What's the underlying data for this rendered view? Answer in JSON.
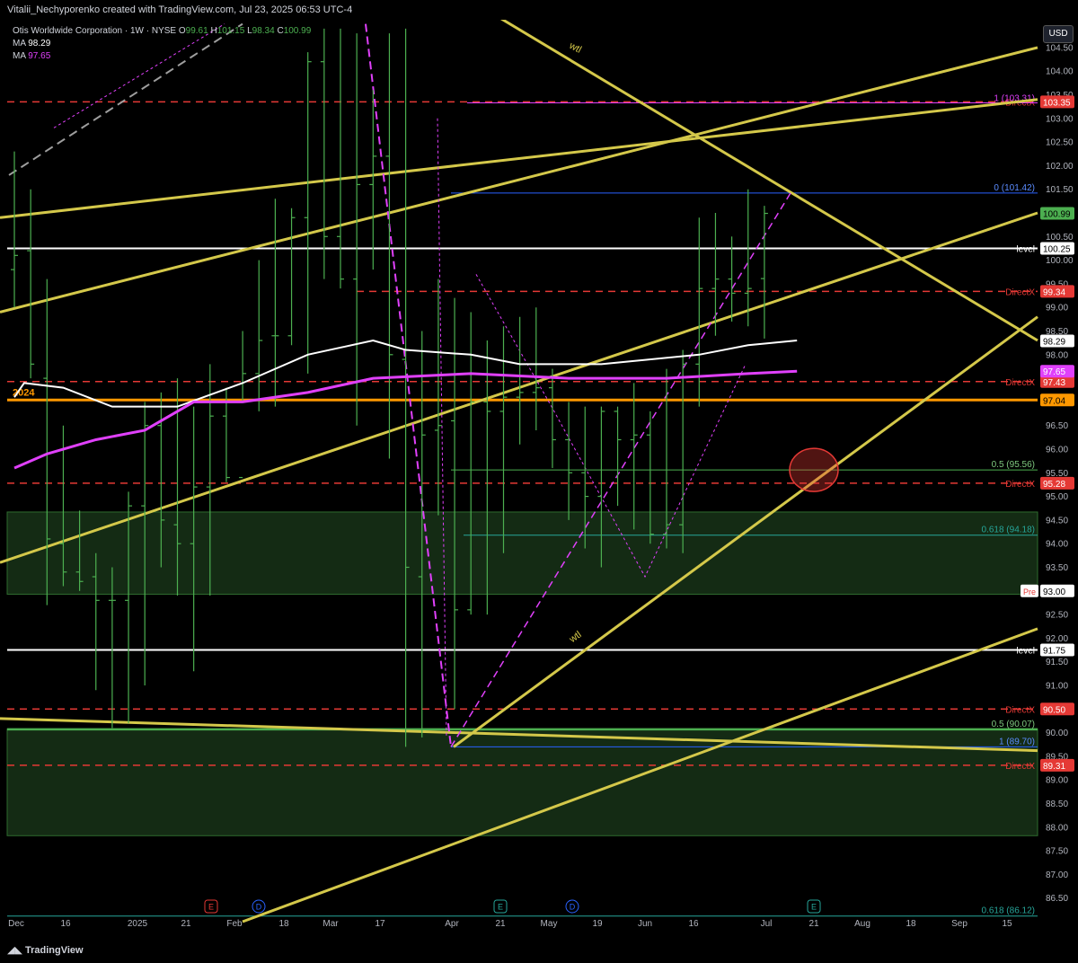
{
  "header": {
    "text": "Vitalii_Nechyporenko created with TradingView.com, Jul 23, 2025 06:53 UTC-4"
  },
  "footer": {
    "brand": "TradingView"
  },
  "legend": {
    "symbol_line": "Otis Worldwide Corporation · 1W · NYSE",
    "o_label": "O",
    "o_value": "99.61",
    "h_label": "H",
    "h_value": "101.15",
    "l_label": "L",
    "l_value": "98.34",
    "c_label": "C",
    "c_value": "100.99",
    "ma1_label": "MA",
    "ma1_value": "98.29",
    "ma2_label": "MA",
    "ma2_value": "97.65"
  },
  "currency_button": "USD",
  "colors": {
    "candle": "#4caf50",
    "ma_white": "#ffffff",
    "ma_magenta": "#e040fb",
    "trend": "#d4c84a",
    "directx": "#e53935",
    "level": "#ffffff",
    "orange": "#ff9800",
    "zone": "#1b3a1b",
    "teal": "#26a69a"
  },
  "chart_data": {
    "type": "line",
    "title": "",
    "y_range": [
      86.0,
      104.9
    ],
    "x_tick_labels": [
      "Dec",
      "16",
      "2025",
      "21",
      "Feb",
      "18",
      "Mar",
      "17",
      "Apr",
      "21",
      "May",
      "19",
      "Jun",
      "16",
      "Jul",
      "21",
      "Aug",
      "18",
      "Sep",
      "15"
    ],
    "y_tick_labels": [
      "104.50",
      "104.00",
      "103.50",
      "103.00",
      "102.50",
      "102.00",
      "101.50",
      "100.50",
      "100.00",
      "99.50",
      "99.00",
      "98.50",
      "98.00",
      "96.50",
      "96.00",
      "95.50",
      "95.00",
      "94.50",
      "94.00",
      "93.50",
      "92.50",
      "92.00",
      "91.50",
      "91.00",
      "90.50",
      "90.00",
      "89.50",
      "89.00",
      "88.50",
      "88.00",
      "87.50",
      "87.00",
      "86.50"
    ],
    "ohlc_weekly": [
      [
        99.8,
        102.3,
        99.0,
        100.1
      ],
      [
        100.2,
        101.5,
        97.5,
        97.8
      ],
      [
        97.5,
        99.6,
        92.7,
        94.1
      ],
      [
        94.0,
        96.5,
        93.1,
        93.4
      ],
      [
        93.4,
        94.7,
        93.0,
        93.2
      ],
      [
        93.3,
        93.8,
        90.9,
        92.8
      ],
      [
        92.8,
        93.5,
        90.1,
        92.8
      ],
      [
        92.8,
        95.1,
        90.2,
        94.8
      ],
      [
        94.8,
        97.0,
        91.0,
        96.5
      ],
      [
        96.5,
        97.2,
        93.5,
        94.5
      ],
      [
        94.4,
        97.5,
        92.9,
        94.0
      ],
      [
        94.0,
        96.9,
        91.3,
        95.2
      ],
      [
        95.2,
        97.8,
        92.9,
        96.7
      ],
      [
        96.7,
        97.3,
        95.3,
        95.4
      ],
      [
        95.4,
        98.5,
        97.0,
        97.6
      ],
      [
        97.6,
        100.0,
        96.8,
        98.3
      ],
      [
        98.4,
        101.3,
        96.9,
        98.4
      ],
      [
        98.4,
        101.1,
        98.2,
        100.9
      ],
      [
        100.9,
        104.4,
        97.6,
        104.2
      ],
      [
        104.2,
        104.9,
        99.6,
        100.5
      ],
      [
        100.5,
        104.9,
        99.4,
        99.6
      ],
      [
        99.6,
        104.8,
        96.5,
        101.6
      ],
      [
        101.6,
        103.6,
        99.8,
        102.2
      ],
      [
        102.2,
        104.8,
        95.8,
        98.0
      ],
      [
        97.9,
        104.9,
        89.7,
        93.5
      ],
      [
        93.3,
        98.5,
        89.9,
        96.3
      ],
      [
        96.4,
        99.6,
        94.6,
        96.5
      ],
      [
        96.6,
        99.2,
        90.5,
        92.6
      ],
      [
        92.6,
        98.9,
        92.5,
        97.0
      ],
      [
        97.0,
        98.3,
        92.5,
        96.8
      ],
      [
        96.8,
        98.6,
        93.8,
        97.1
      ],
      [
        97.1,
        98.8,
        96.1,
        97.2
      ],
      [
        97.2,
        99.0,
        96.4,
        97.3
      ],
      [
        97.3,
        97.7,
        95.6,
        96.2
      ],
      [
        96.2,
        97.0,
        94.5,
        95.5
      ],
      [
        95.5,
        96.9,
        93.9,
        95.0
      ],
      [
        95.0,
        96.9,
        93.5,
        96.8
      ],
      [
        96.8,
        96.9,
        94.8,
        96.2
      ],
      [
        96.2,
        97.4,
        94.3,
        96.3
      ],
      [
        96.3,
        96.8,
        94.0,
        94.2
      ],
      [
        94.2,
        97.7,
        93.9,
        94.4
      ],
      [
        94.4,
        98.1,
        93.8,
        97.8
      ],
      [
        97.8,
        100.9,
        96.9,
        99.4
      ],
      [
        99.4,
        101.0,
        98.4,
        99.6
      ],
      [
        99.6,
        100.5,
        98.7,
        99.3
      ],
      [
        99.3,
        101.5,
        98.6,
        99.4
      ],
      [
        99.61,
        101.15,
        98.34,
        100.99
      ]
    ],
    "ma_white_points": [
      [
        0,
        97.1
      ],
      [
        0.6,
        97.4
      ],
      [
        3,
        97.3
      ],
      [
        6,
        96.9
      ],
      [
        10,
        96.9
      ],
      [
        14,
        97.4
      ],
      [
        18,
        98.0
      ],
      [
        22,
        98.3
      ],
      [
        24,
        98.1
      ],
      [
        28,
        98.0
      ],
      [
        31,
        97.8
      ],
      [
        36,
        97.8
      ],
      [
        42,
        98.0
      ],
      [
        45,
        98.2
      ],
      [
        48,
        98.3
      ]
    ],
    "ma_magenta_points": [
      [
        0,
        95.6
      ],
      [
        2,
        95.9
      ],
      [
        5,
        96.2
      ],
      [
        8,
        96.4
      ],
      [
        11,
        97.0
      ],
      [
        14,
        97.0
      ],
      [
        18,
        97.2
      ],
      [
        22,
        97.5
      ],
      [
        28,
        97.6
      ],
      [
        34,
        97.5
      ],
      [
        40,
        97.5
      ],
      [
        45,
        97.6
      ],
      [
        48,
        97.65
      ]
    ],
    "horizontal_levels": [
      {
        "name": "directx",
        "label": "DirectX",
        "price": 103.35,
        "tag": "103.35",
        "style": "dashed"
      },
      {
        "name": "directx",
        "label": "DirectX",
        "price": 99.34,
        "tag": "99.34",
        "style": "dashed"
      },
      {
        "name": "directx",
        "label": "DirectX",
        "price": 97.43,
        "tag": "97.43",
        "style": "dashed"
      },
      {
        "name": "directx",
        "label": "DirectX",
        "price": 95.28,
        "tag": "95.28",
        "style": "dashed"
      },
      {
        "name": "directx",
        "label": "DirectX",
        "price": 90.5,
        "tag": "90.50",
        "style": "dashed"
      },
      {
        "name": "directx",
        "label": "DirectX",
        "price": 89.31,
        "tag": "89.31",
        "style": "dashed"
      },
      {
        "name": "level",
        "label": "level",
        "price": 100.25,
        "tag": "100.25",
        "style": "solid"
      },
      {
        "name": "level",
        "label": "level",
        "price": 91.75,
        "tag": "91.75",
        "style": "solid"
      },
      {
        "name": "orange",
        "label": "2024",
        "price": 97.04,
        "tag": "97.04",
        "style": "solid"
      }
    ],
    "fib_labels": [
      {
        "label": "1 (103.31)",
        "price": 103.31
      },
      {
        "label": "0 (101.42)",
        "price": 101.42
      },
      {
        "label": "0.5 (95.56)",
        "price": 95.56
      },
      {
        "label": "0.618 (94.18)",
        "price": 94.18
      },
      {
        "label": "0.5 (90.07)",
        "price": 90.07
      },
      {
        "label": "1 (89.70)",
        "price": 89.7
      },
      {
        "label": "0.618 (86.12)",
        "price": 86.12
      }
    ],
    "price_tags": [
      {
        "value": "100.99",
        "price": 100.99,
        "color": "#4caf50",
        "text_color": "#000"
      },
      {
        "value": "98.29",
        "price": 98.29,
        "color": "#ffffff",
        "text_color": "#000"
      },
      {
        "value": "97.65",
        "price": 97.65,
        "color": "#e040fb",
        "text_color": "#fff"
      },
      {
        "value": "93.00",
        "price": 93.0,
        "color": "#ffffff",
        "text_color": "#000",
        "prefix": "Pre"
      }
    ],
    "zones": [
      {
        "from": 94.67,
        "to": 92.93
      },
      {
        "from": 90.08,
        "to": 87.82
      }
    ],
    "trendline_label": "wtl",
    "event_markers": [
      "E",
      "D",
      "E",
      "D",
      "E"
    ]
  }
}
